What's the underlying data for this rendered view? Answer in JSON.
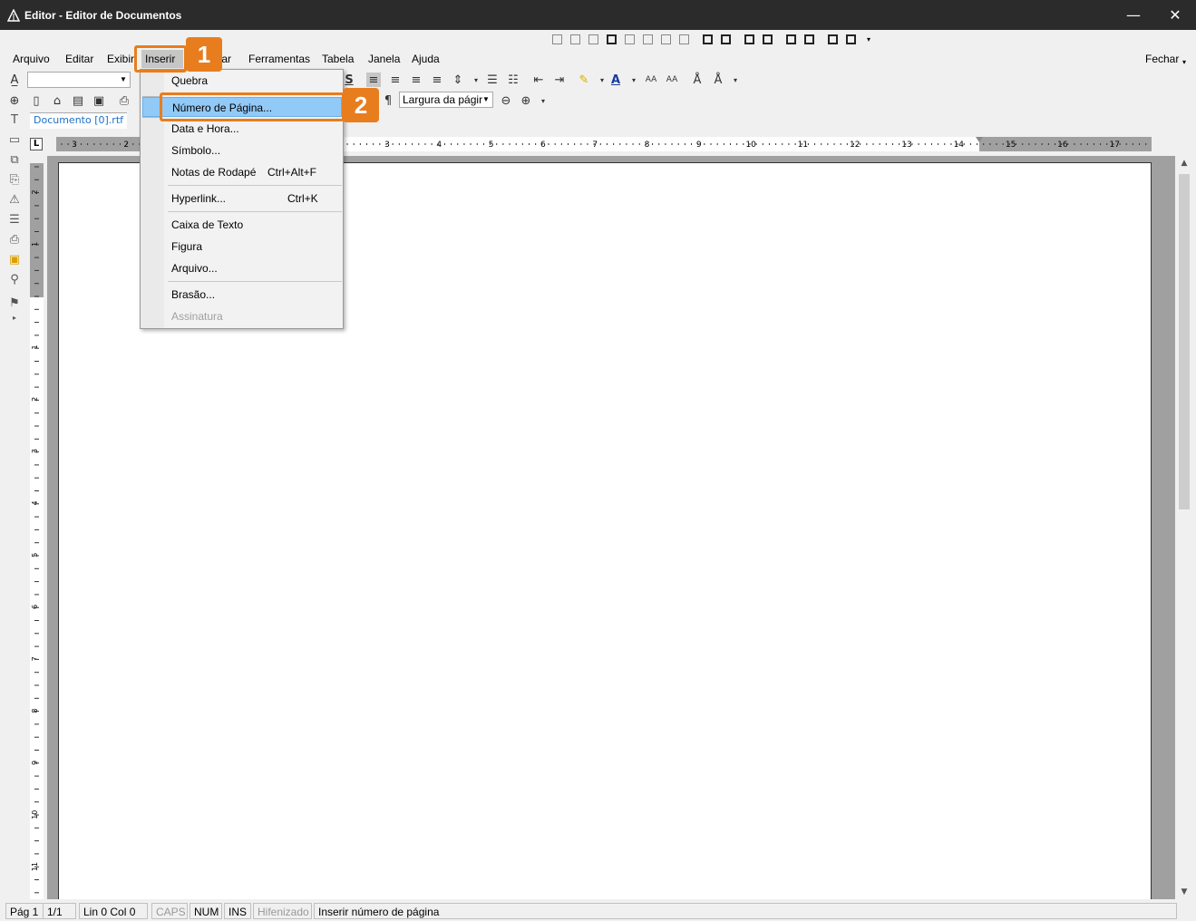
{
  "window": {
    "title": "Editor - Editor de Documentos",
    "minimize_glyph": "—",
    "close_glyph": "✕",
    "app_icon": "triangle-app-icon"
  },
  "menubar": {
    "items": [
      {
        "label": "Arquivo",
        "name": "menu-arquivo"
      },
      {
        "label": "Editar",
        "name": "menu-editar"
      },
      {
        "label": "Exibir",
        "name": "menu-exibir"
      },
      {
        "label": "Inserir",
        "name": "menu-inserir"
      },
      {
        "label": "tar",
        "name": "menu-formatar"
      },
      {
        "label": "Ferramentas",
        "name": "menu-ferramentas"
      },
      {
        "label": "Tabela",
        "name": "menu-tabela"
      },
      {
        "label": "Janela",
        "name": "menu-janela"
      },
      {
        "label": "Ajuda",
        "name": "menu-ajuda"
      }
    ],
    "close_label": "Fechar"
  },
  "toolbar": {
    "zoom_value": "Largura da págir",
    "bold_glyph": "S",
    "pilcrow_glyph": "¶"
  },
  "document_tab": "Documento [0].rtf",
  "ruler": {
    "h_left_labels": [
      "3",
      "2"
    ],
    "h_labels": [
      "3",
      "4",
      "5",
      "6",
      "7",
      "8",
      "9",
      "10",
      "11",
      "12",
      "13",
      "14",
      "15",
      "16",
      "17"
    ],
    "v_top_labels": [
      "2",
      "1"
    ],
    "v_labels": [
      "1",
      "2",
      "3",
      "4",
      "5",
      "6",
      "7",
      "8",
      "9",
      "10",
      "11"
    ],
    "tab_corner": "L"
  },
  "dropdown": {
    "items": [
      {
        "label": "Quebra",
        "shortcut": "",
        "state": "normal"
      },
      {
        "label": "Número de Página...",
        "shortcut": "",
        "state": "highlighted"
      },
      {
        "label": "Data e Hora...",
        "shortcut": "",
        "state": "normal"
      },
      {
        "label": "Símbolo...",
        "shortcut": "",
        "state": "normal"
      },
      {
        "label": "Notas de Rodapé",
        "shortcut": "Ctrl+Alt+F",
        "state": "normal"
      },
      {
        "label": "Hyperlink...",
        "shortcut": "Ctrl+K",
        "state": "normal"
      },
      {
        "label": "Caixa de Texto",
        "shortcut": "",
        "state": "normal"
      },
      {
        "label": "Figura",
        "shortcut": "",
        "state": "normal"
      },
      {
        "label": "Arquivo...",
        "shortcut": "",
        "state": "normal"
      },
      {
        "label": "Brasão...",
        "shortcut": "",
        "state": "normal"
      },
      {
        "label": "Assinatura",
        "shortcut": "",
        "state": "disabled"
      }
    ]
  },
  "callouts": {
    "step1": "1",
    "step2": "2",
    "color": "#e87d1e"
  },
  "statusbar": {
    "page": "Pág 1",
    "page_count": "1/1",
    "position": "Lin 0  Col 0",
    "caps": "CAPS",
    "num": "NUM",
    "ins": "INS",
    "hyphen": "Hifenizado",
    "message": "Inserir número de página"
  }
}
